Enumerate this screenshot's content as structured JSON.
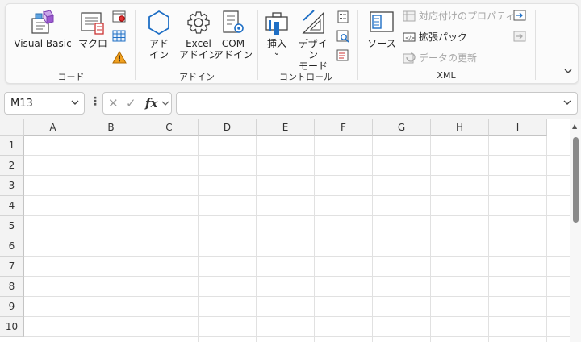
{
  "ribbon": {
    "groups": {
      "code": "コード",
      "addins": "アドイン",
      "controls": "コントロール",
      "xml": "XML"
    },
    "buttons": {
      "visual_basic": "Visual Basic",
      "macro": "マクロ",
      "addin_line1": "アド",
      "addin_line2": "イン",
      "excel_addin_line1": "Excel",
      "excel_addin_line2": "アドイン",
      "com_addin_line1": "COM",
      "com_addin_line2": "アドイン",
      "insert": "挿入",
      "design_line1": "デザイン",
      "design_line2": "モード",
      "source": "ソース",
      "map_properties": "対応付けのプロパティ",
      "expansion_packs": "拡張パック",
      "refresh_data": "データの更新"
    },
    "collapse_icon": "chevron-down-icon"
  },
  "namebox": {
    "value": "M13"
  },
  "formula_bar": {
    "value": "",
    "fx_label": "fx"
  },
  "sheet": {
    "columns": [
      "A",
      "B",
      "C",
      "D",
      "E",
      "F",
      "G",
      "H",
      "I"
    ],
    "rows": [
      "1",
      "2",
      "3",
      "4",
      "5",
      "6",
      "7",
      "8",
      "9",
      "10"
    ]
  }
}
